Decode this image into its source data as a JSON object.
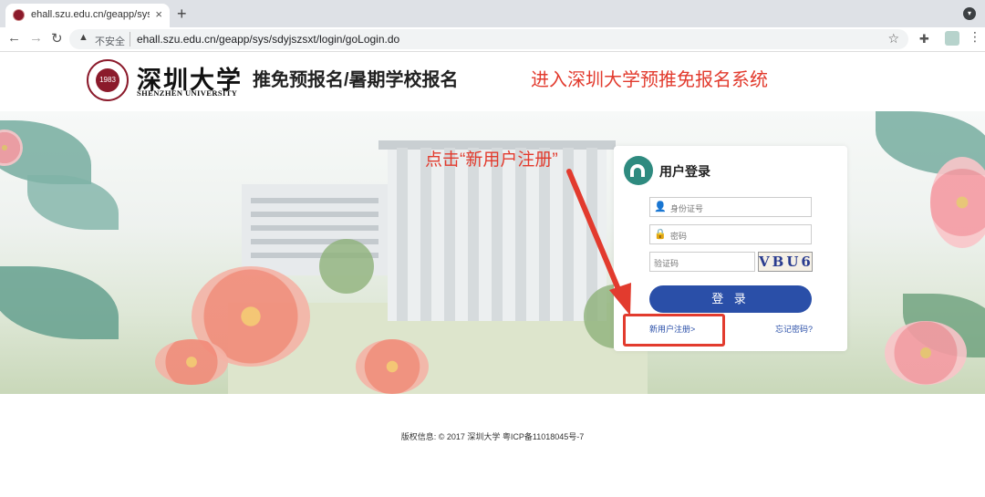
{
  "browser": {
    "tab_title": "ehall.szu.edu.cn/geapp/sys/sd",
    "tab_close": "×",
    "new_tab": "+",
    "security_label": "不安全",
    "url": "ehall.szu.edu.cn/geapp/sys/sdyjszsxt/login/goLogin.do",
    "back_icon": "←",
    "forward_icon": "→",
    "reload_icon": "↻",
    "star_icon": "☆",
    "menu_icon": "⋮"
  },
  "header": {
    "logo_cn": "深圳大学",
    "logo_en": "SHENZHEN UNIVERSITY",
    "seal_text": "1983",
    "title": "推免预报名/暑期学校报名",
    "annotation": "进入深圳大学预推免报名系统"
  },
  "login": {
    "title": "用户登录",
    "id_placeholder": "身份证号",
    "password_placeholder": "密码",
    "captcha_placeholder": "验证码",
    "captcha_text": "VBU6",
    "login_button": "登 录",
    "register_link": "新用户注册>",
    "forgot_link": "忘记密码?"
  },
  "annotation_mid": "点击“新用户注册”",
  "footer": {
    "copyright": "版权信息: © 2017 深圳大学 粤ICP备11018045号-7"
  },
  "colors": {
    "accent_red": "#e23b2e",
    "button_blue": "#2a4fa8",
    "brand_maroon": "#8b1a2b"
  }
}
